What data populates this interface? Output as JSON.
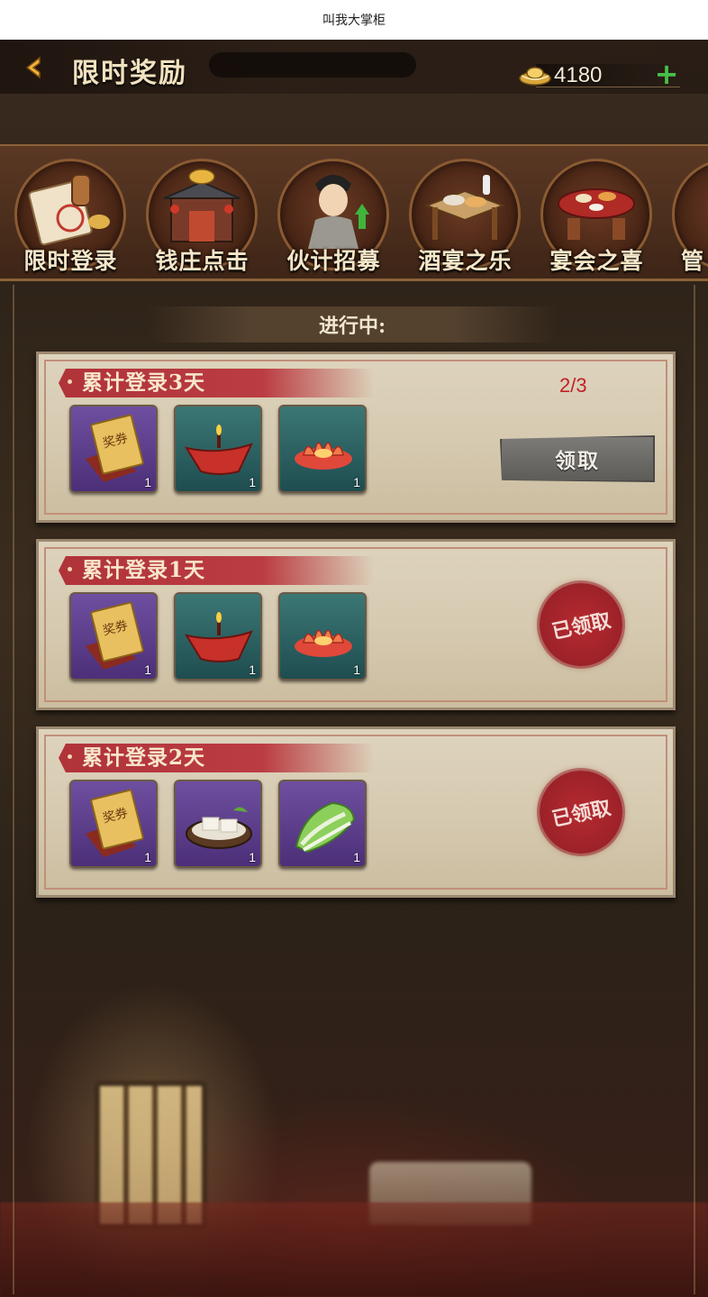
{
  "app_title": "叫我大掌柜",
  "header": {
    "title": "限时奖励",
    "currency_value": "4180",
    "plus_label": "+"
  },
  "tabs": [
    {
      "label": "限时登录"
    },
    {
      "label": "钱庄点击"
    },
    {
      "label": "伙计招募"
    },
    {
      "label": "酒宴之乐"
    },
    {
      "label": "宴会之喜"
    },
    {
      "label": "管"
    }
  ],
  "section": {
    "status": "进行中:"
  },
  "cards": [
    {
      "title": "累计登录3天",
      "progress": "2/3",
      "button": "领取",
      "items": [
        {
          "icon": "reward-voucher-icon",
          "count": "1"
        },
        {
          "icon": "red-ingot-icon",
          "count": "1"
        },
        {
          "icon": "lotus-lamp-icon",
          "count": "1"
        }
      ]
    },
    {
      "title": "累计登录1天",
      "stamp": "已领取",
      "items": [
        {
          "icon": "reward-voucher-icon",
          "count": "1"
        },
        {
          "icon": "red-ingot-icon",
          "count": "1"
        },
        {
          "icon": "lotus-lamp-icon",
          "count": "1"
        }
      ]
    },
    {
      "title": "累计登录2天",
      "stamp": "已领取",
      "items": [
        {
          "icon": "reward-voucher-icon",
          "count": "1"
        },
        {
          "icon": "tofu-icon",
          "count": "1"
        },
        {
          "icon": "cabbage-icon",
          "count": "1"
        }
      ]
    }
  ],
  "voucher_text": "奖券",
  "colors": {
    "accent_red": "#b0333a",
    "progress_red": "#c02229",
    "plus_green": "#47c04a"
  }
}
